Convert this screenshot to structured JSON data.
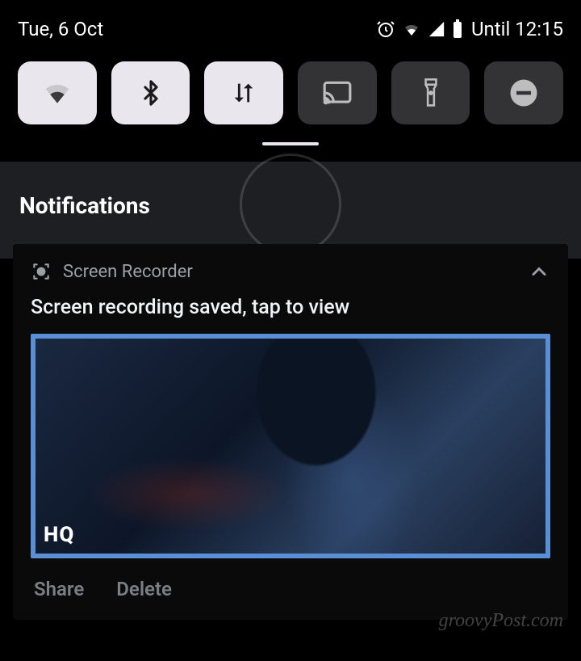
{
  "status": {
    "date": "Tue, 6 Oct",
    "until_label": "Until 12:15"
  },
  "notifications": {
    "header": "Notifications"
  },
  "notif": {
    "app_name": "Screen Recorder",
    "title": "Screen recording saved, tap to view",
    "hq_badge": "HQ",
    "actions": {
      "share": "Share",
      "delete": "Delete"
    }
  },
  "watermark": "groovyPost.com"
}
